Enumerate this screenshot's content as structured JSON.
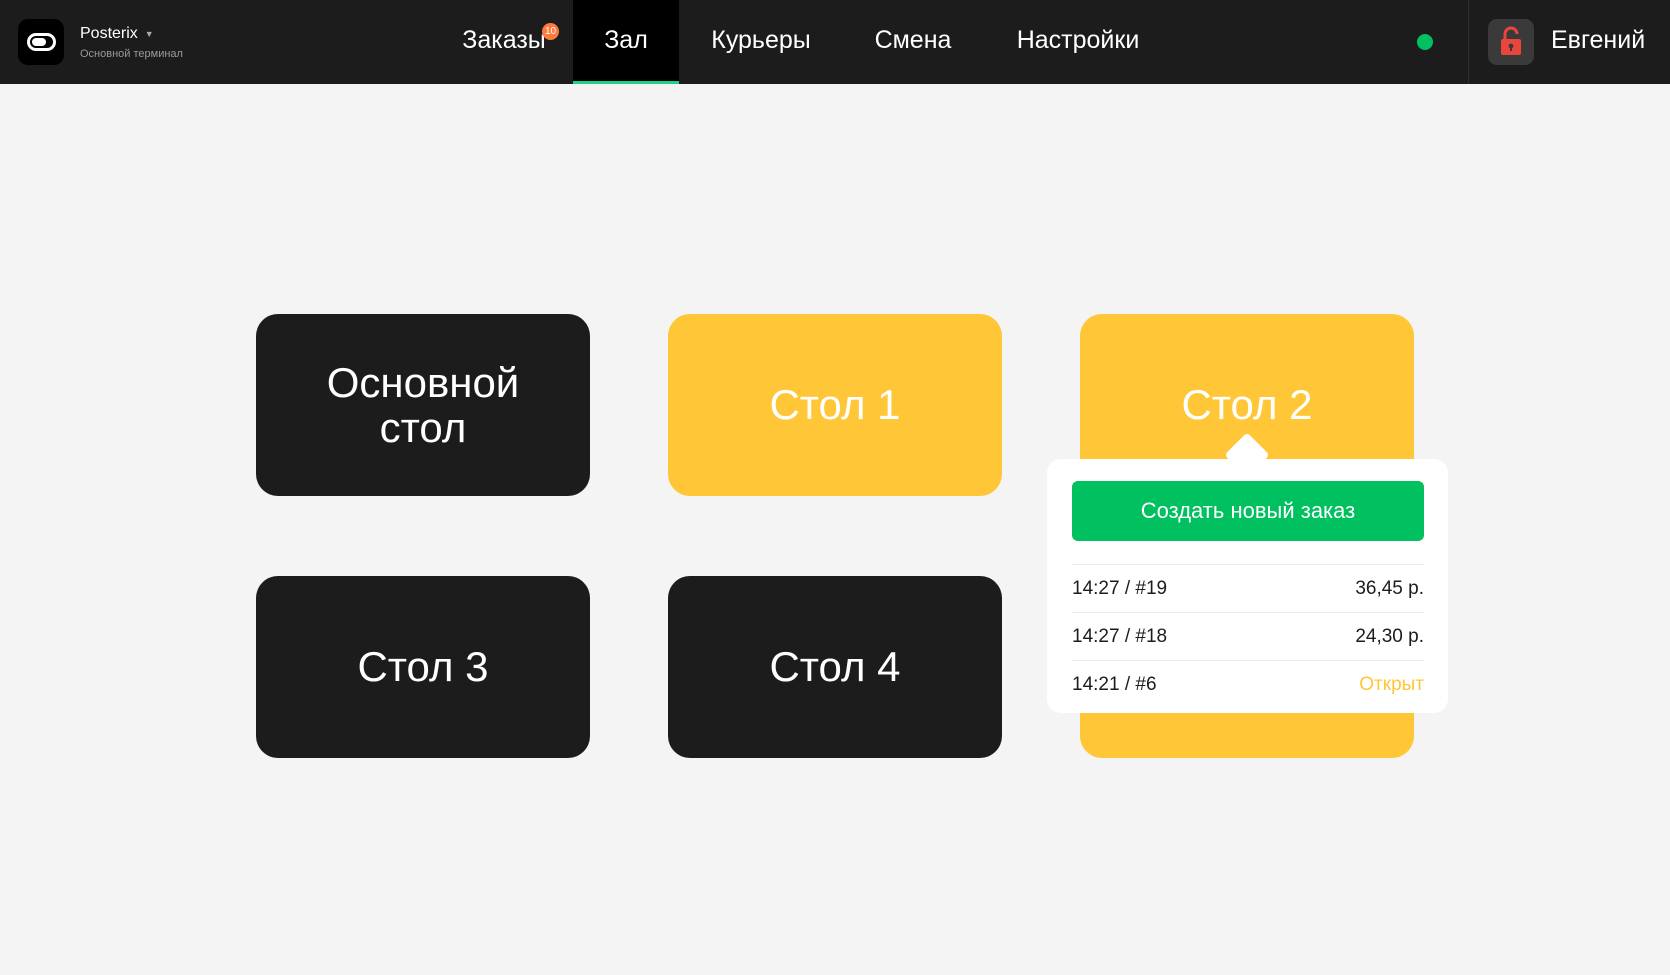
{
  "app": {
    "name": "Posterix",
    "terminal": "Основной терминал"
  },
  "nav": {
    "orders": {
      "label": "Заказы",
      "badge": "10"
    },
    "hall": {
      "label": "Зал"
    },
    "couriers": {
      "label": "Курьеры"
    },
    "shift": {
      "label": "Смена"
    },
    "settings": {
      "label": "Настройки"
    }
  },
  "user": {
    "name": "Евгений"
  },
  "colors": {
    "accent_green": "#00c060",
    "table_busy": "#ffc638",
    "table_free": "#1c1c1c",
    "badge": "#ff7a3d",
    "lock": "#e8453c"
  },
  "tables": [
    {
      "label": "Основной стол",
      "state": "free"
    },
    {
      "label": "Стол 1",
      "state": "busy"
    },
    {
      "label": "Стол 2",
      "state": "busy"
    },
    {
      "label": "Стол 3",
      "state": "free"
    },
    {
      "label": "Стол 4",
      "state": "free"
    }
  ],
  "popover": {
    "create_label": "Создать новый заказ",
    "orders": [
      {
        "time_id": "14:27 / #19",
        "value": "36,45 р."
      },
      {
        "time_id": "14:27 / #18",
        "value": "24,30 р."
      },
      {
        "time_id": "14:21 / #6",
        "value": "Открыт"
      }
    ]
  }
}
